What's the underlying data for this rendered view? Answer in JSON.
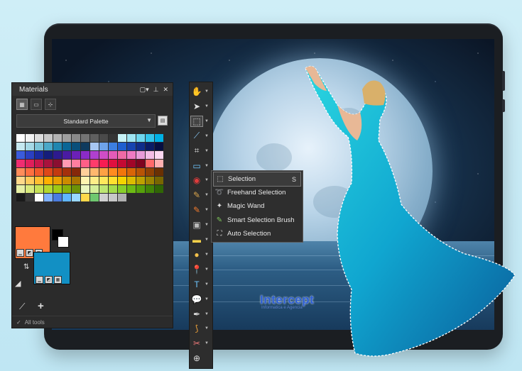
{
  "watermark": {
    "brand": "Intercept",
    "tagline": "Informatica e Agencia"
  },
  "materials": {
    "title": "Materials",
    "palette_select": "Standard Palette",
    "all_tools": "All tools",
    "fg_color": "#ff7a3d",
    "bg_color": "#1290c4",
    "swatch_rows": [
      [
        "#ffffff",
        "#f2f2f2",
        "#dddddd",
        "#c8c8c8",
        "#b3b3b3",
        "#9e9e9e",
        "#898989",
        "#747474",
        "#5f5f5f",
        "#4a4a4a",
        "#353535",
        "#c7f3f7",
        "#9fe5f2",
        "#6fd7ee",
        "#33c5eb",
        "#00b1e5"
      ],
      [
        "#c5e8f0",
        "#a6d9e6",
        "#7bc4d8",
        "#4aa8c8",
        "#1f86b0",
        "#0a6696",
        "#0a4f7a",
        "#0e3a5e",
        "#a7c6f2",
        "#6fa3ea",
        "#3c7fe1",
        "#1f5fd0",
        "#1644b0",
        "#0f2d8a",
        "#0a1c66",
        "#060f42"
      ],
      [
        "#3b5bdc",
        "#2a3fc2",
        "#1b2aa0",
        "#141d7c",
        "#2d1a8f",
        "#4a1ba2",
        "#6b20b7",
        "#8a2bc7",
        "#b040cf",
        "#cf4dc6",
        "#e35bb8",
        "#f06aa6",
        "#ef7ac3",
        "#e89bd9",
        "#f3bde6",
        "#fbd8f1"
      ],
      [
        "#f02d71",
        "#e01f5b",
        "#c8174a",
        "#a9123d",
        "#8a0e31",
        "#ff9ab4",
        "#ff7ea0",
        "#ff5f87",
        "#ff3c6b",
        "#f81d52",
        "#e0103f",
        "#c40a33",
        "#a10628",
        "#7e041f",
        "#ff6a6a",
        "#ffb0b0"
      ],
      [
        "#ff8d5a",
        "#ff7040",
        "#f25a2a",
        "#de4719",
        "#c33a10",
        "#a4300c",
        "#86280a",
        "#ffcf9a",
        "#ffb86e",
        "#ffa144",
        "#ff8b1f",
        "#f2760b",
        "#d96507",
        "#b85405",
        "#8f4104",
        "#6a3003"
      ],
      [
        "#ffd98a",
        "#ffcc5c",
        "#ffbf2f",
        "#ffb000",
        "#e8a000",
        "#cc8c00",
        "#a97400",
        "#fff4b0",
        "#ffee88",
        "#ffe85c",
        "#ffe02f",
        "#f5d400",
        "#dcbc00",
        "#bda100",
        "#9a8300",
        "#786600"
      ],
      [
        "#e6f0a4",
        "#d8ea7c",
        "#c7e255",
        "#b4d72e",
        "#9fc914",
        "#86b20a",
        "#6c9207",
        "#eaf7c0",
        "#d4ef9a",
        "#bde673",
        "#a4dc4c",
        "#88cf2a",
        "#6dbb14",
        "#56a10b",
        "#418407",
        "#306505"
      ],
      [
        "#1a1a1a",
        "#3a3a3a",
        "#ffffff",
        "#7fb0ff",
        "#4a7ce0",
        "#5fb6ff",
        "#9ad8ff",
        "#ffd84a",
        "#6fc86f",
        "#d0d0d0",
        "#c8c8c8",
        "#b0b0b0",
        "#2b2b2b",
        "#2b2b2b",
        "#2b2b2b",
        "#2b2b2b"
      ]
    ]
  },
  "toolbar": {
    "tools": [
      {
        "icon": "pan-hand-icon",
        "glyph": "✋",
        "color": "#f2b13c"
      },
      {
        "icon": "pick-arrow-icon",
        "glyph": "➤",
        "color": "#dddddd"
      },
      {
        "icon": "selection-marquee-icon",
        "glyph": "⬚",
        "color": "#dddddd"
      },
      {
        "icon": "dropper-icon",
        "glyph": "⟋",
        "color": "#8fd0ff"
      },
      {
        "icon": "crop-icon",
        "glyph": "⌗",
        "color": "#dddddd"
      },
      {
        "icon": "straighten-icon",
        "glyph": "▭",
        "color": "#6fc7ff"
      },
      {
        "icon": "red-eye-icon",
        "glyph": "◉",
        "color": "#e03c3c"
      },
      {
        "icon": "makeover-brush-icon",
        "glyph": "✎",
        "color": "#d9a44c"
      },
      {
        "icon": "paint-brush-icon",
        "glyph": "✎",
        "color": "#f07a2e"
      },
      {
        "icon": "gradient-fill-icon",
        "glyph": "▣",
        "color": "#bbbbbb"
      },
      {
        "icon": "eraser-icon",
        "glyph": "▬",
        "color": "#f5d04a"
      },
      {
        "icon": "retouch-icon",
        "glyph": "●",
        "color": "#f3c04a"
      },
      {
        "icon": "push-pin-icon",
        "glyph": "📍",
        "color": "#e03c3c"
      },
      {
        "icon": "text-icon",
        "glyph": "T",
        "color": "#6fc7ff"
      },
      {
        "icon": "shape-speech-icon",
        "glyph": "💬",
        "color": "#6fc7ff"
      },
      {
        "icon": "pen-icon",
        "glyph": "✒",
        "color": "#dddddd"
      },
      {
        "icon": "warp-brush-icon",
        "glyph": "⟆",
        "color": "#f0a33a"
      },
      {
        "icon": "object-remover-icon",
        "glyph": "✂",
        "color": "#f07a7a"
      },
      {
        "icon": "add-tool-icon",
        "glyph": "⊕",
        "color": "#dddddd"
      }
    ]
  },
  "selection_menu": {
    "items": [
      {
        "label": "Selection",
        "shortcut": "S",
        "icon": "rect-selection-icon",
        "glyph": "⬚",
        "color": "#dddddd"
      },
      {
        "label": "Freehand Selection",
        "shortcut": "",
        "icon": "lasso-icon",
        "glyph": "➰",
        "color": "#f5c84a"
      },
      {
        "label": "Magic Wand",
        "shortcut": "",
        "icon": "magic-wand-icon",
        "glyph": "✦",
        "color": "#dddddd"
      },
      {
        "label": "Smart Selection Brush",
        "shortcut": "",
        "icon": "smart-brush-icon",
        "glyph": "✎",
        "color": "#7ec65a"
      },
      {
        "label": "Auto Selection",
        "shortcut": "",
        "icon": "auto-selection-icon",
        "glyph": "⛶",
        "color": "#dddddd"
      }
    ]
  }
}
